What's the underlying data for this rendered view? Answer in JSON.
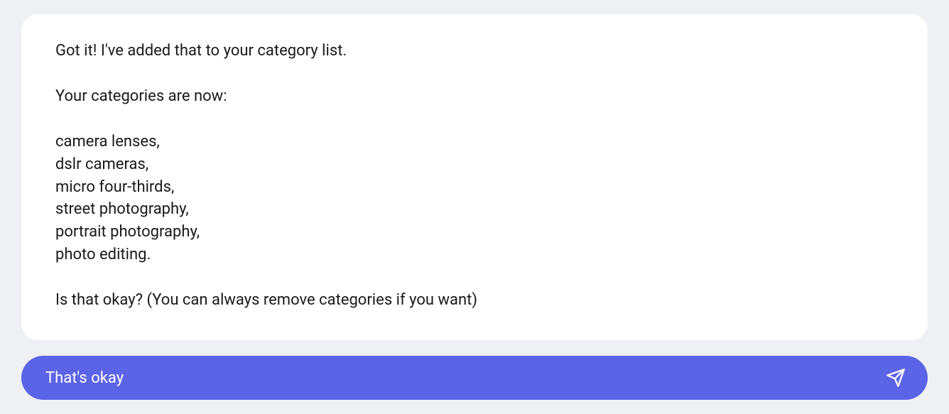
{
  "message": {
    "intro": "Got it! I've added that to your category list.",
    "subhead": "Your categories are now:",
    "categories": [
      "camera lenses,",
      "dslr cameras,",
      "micro four-thirds,",
      "street photography,",
      "portrait photography,",
      "photo editing."
    ],
    "confirm_question": "Is that okay? (You can always remove categories if you want)"
  },
  "input": {
    "value": "That's okay"
  },
  "colors": {
    "accent": "#5b63e6",
    "page_bg": "#eef0f4",
    "card_bg": "#ffffff"
  }
}
